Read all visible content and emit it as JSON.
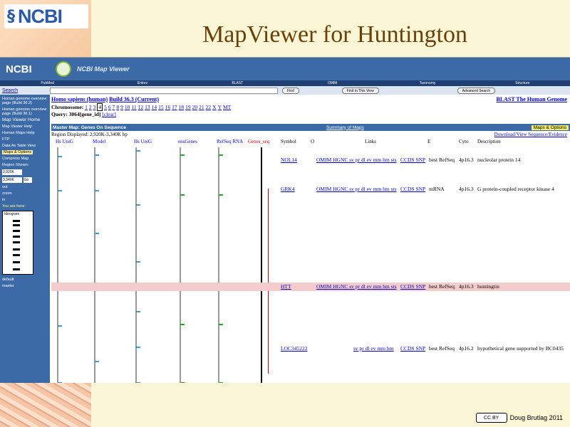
{
  "slide": {
    "title": "MapViewer for Huntington",
    "logo_text": "NCBI",
    "credit": "Doug Brutlag 2011",
    "cc_label": "CC BY"
  },
  "header": {
    "logo": "NCBI",
    "app_title": "NCBI Map Viewer"
  },
  "nav": [
    "PubMed",
    "Entrez",
    "BLAST",
    "OMIM",
    "Taxonomy",
    "Structure"
  ],
  "search": {
    "label": "Search",
    "find": "Find",
    "find_view": "Find in This View",
    "advanced": "Advanced Search"
  },
  "sidebar": {
    "items": [
      "Human genome overview page (Build 36.3)",
      "Human genome overview page (Build 36.1)"
    ],
    "home": "Map Viewer Home",
    "links": [
      "Map Viewer Help",
      "Human Maps Help",
      "FTP",
      "Data As Table View"
    ],
    "maps_options": "Maps & Options",
    "compress": "Compress Map",
    "region_shown": "Region Shown:",
    "from": "2,920K",
    "to": "3,340K",
    "go": "Go",
    "zoom": [
      "out",
      "zoom",
      "in"
    ],
    "you_are_here": "You are here:",
    "ideogram": "Ideogram",
    "radios": [
      "default",
      "master"
    ]
  },
  "main": {
    "organism": "Homo sapiens (human)",
    "build": "Build 36.3 (Current)",
    "blast": "BLAST The Human Genome",
    "chromosome_label": "Chromosome:",
    "chromosomes": [
      "1",
      "2",
      "3",
      "4",
      "5",
      "6",
      "7",
      "8",
      "9",
      "10",
      "11",
      "12",
      "13",
      "14",
      "15",
      "16",
      "17",
      "18",
      "19",
      "20",
      "21",
      "22",
      "X",
      "Y",
      "MT"
    ],
    "query": "Query: 3064[gene_id]",
    "clear": "[clear]",
    "master_map": "Master Map: Genes On Sequence",
    "summary": "Summary of Maps",
    "maps_options": "Maps & Options",
    "region": "Region Displayed: 2,920K-3,340K bp",
    "download": "Download/View Sequence/Evidence",
    "track_headers": [
      "Hs UniG",
      "Model",
      "Hs UniG",
      "ensGenes",
      "RefSeq RNA",
      "Genes_seq"
    ],
    "columns": {
      "symbol": "Symbol",
      "o": "O",
      "links": "Links",
      "e": "E",
      "cyto": "Cyto",
      "description": "Description"
    },
    "genes": [
      {
        "symbol": "NOL14",
        "links": "OMIM HGNC sv pr dl ev mm hm sts",
        "extra": "CCDS SNP",
        "refseq": "best RefSeq",
        "cyto": "4p16.3",
        "desc": "nucleolar protein 14"
      },
      {
        "symbol": "GRK4",
        "links": "OMIM HGNC sv pr dl ev mm hm sts",
        "extra": "CCDS SNP",
        "refseq": "mRNA",
        "cyto": "4p16.3",
        "desc": "G protein-coupled receptor kinase 4"
      },
      {
        "symbol": "HTT",
        "links": "OMIM HGNC sv pr dl ev mm hm sts",
        "extra": "CCDS SNP",
        "refseq": "best RefSeq",
        "cyto": "4p16.3",
        "desc": "huntingtin"
      },
      {
        "symbol": "LOC345222",
        "links": "sv pr dl ev mm hm",
        "extra": "CCDS SNP",
        "refseq": "best RefSeq",
        "cyto": "4p16.2",
        "desc": "hypothetical gene supported by BC0435"
      }
    ]
  },
  "colors": {
    "accent": "#3b6aa6",
    "highlight": "#f4cccc",
    "title": "#6b3f08"
  }
}
